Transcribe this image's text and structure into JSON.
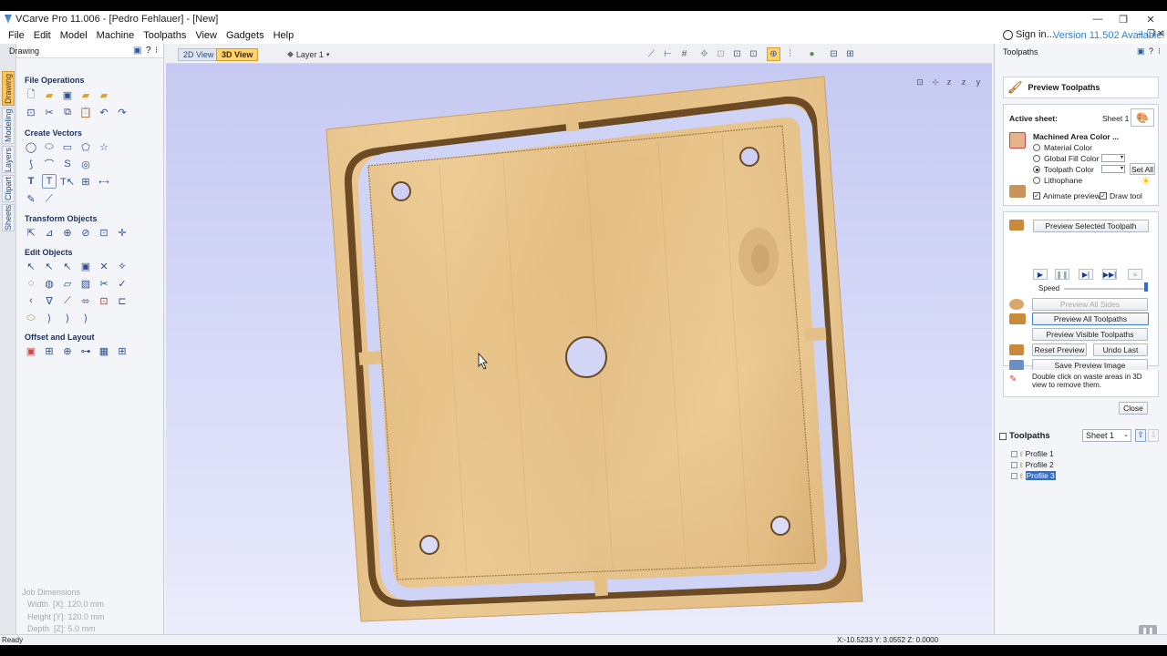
{
  "window": {
    "title": "VCarve Pro 11.006 - [Pedro Fehlauer] - [New]"
  },
  "menu": {
    "items": [
      "File",
      "Edit",
      "Model",
      "Machine",
      "Toolpaths",
      "View",
      "Gadgets",
      "Help"
    ],
    "sign_in": "Sign in...",
    "version": "Version 11.502 Available!"
  },
  "left_panel": {
    "title": "Drawing",
    "tabs": [
      "Drawing",
      "Modeling",
      "Layers",
      "Clipart",
      "Sheets"
    ],
    "sections": {
      "file_ops": "File Operations",
      "create_vectors": "Create Vectors",
      "transform": "Transform Objects",
      "edit": "Edit Objects",
      "offset": "Offset and Layout"
    },
    "job": {
      "title": "Job Dimensions",
      "width": "Width  [X]: 120.0 mm",
      "height": "Height [Y]: 120.0 mm",
      "depth": "Depth  [Z]: 5.0 mm"
    }
  },
  "view_toolbar": {
    "tab_2d": "2D View",
    "tab_3d": "3D View",
    "layer": "Layer 1"
  },
  "toolpaths_panel": {
    "title": "Toolpaths",
    "preview_title": "Preview Toolpaths",
    "active_sheet_label": "Active sheet:",
    "active_sheet": "Sheet 1",
    "machined_color": "Machined Area Color ...",
    "options": [
      "Material Color",
      "Global Fill Color",
      "Toolpath Color",
      "Lithophane"
    ],
    "set_all": "Set All",
    "animate_preview": "Animate preview",
    "draw_tool": "Draw tool",
    "preview_selected": "Preview Selected Toolpath",
    "speed": "Speed",
    "preview_all_sides": "Preview All Sides",
    "preview_all": "Preview All Toolpaths",
    "preview_visible": "Preview Visible Toolpaths",
    "reset_preview": "Reset Preview",
    "undo_last": "Undo Last",
    "save_image": "Save Preview Image",
    "hint": "Double click on waste areas in 3D view to remove them.",
    "close": "Close",
    "list_title": "Toolpaths",
    "list_sheet": "Sheet 1",
    "items": [
      "Profile 1",
      "Profile 2",
      "Profile 3"
    ]
  },
  "status": {
    "left": "Ready",
    "coords": "X:-10.5233 Y: 3.0552 Z: 0.0000"
  },
  "colors": {
    "accent": "#ffd36a",
    "wood": "#e8c38b",
    "selection": "#2f6fd1",
    "link": "#2f7fd0"
  }
}
